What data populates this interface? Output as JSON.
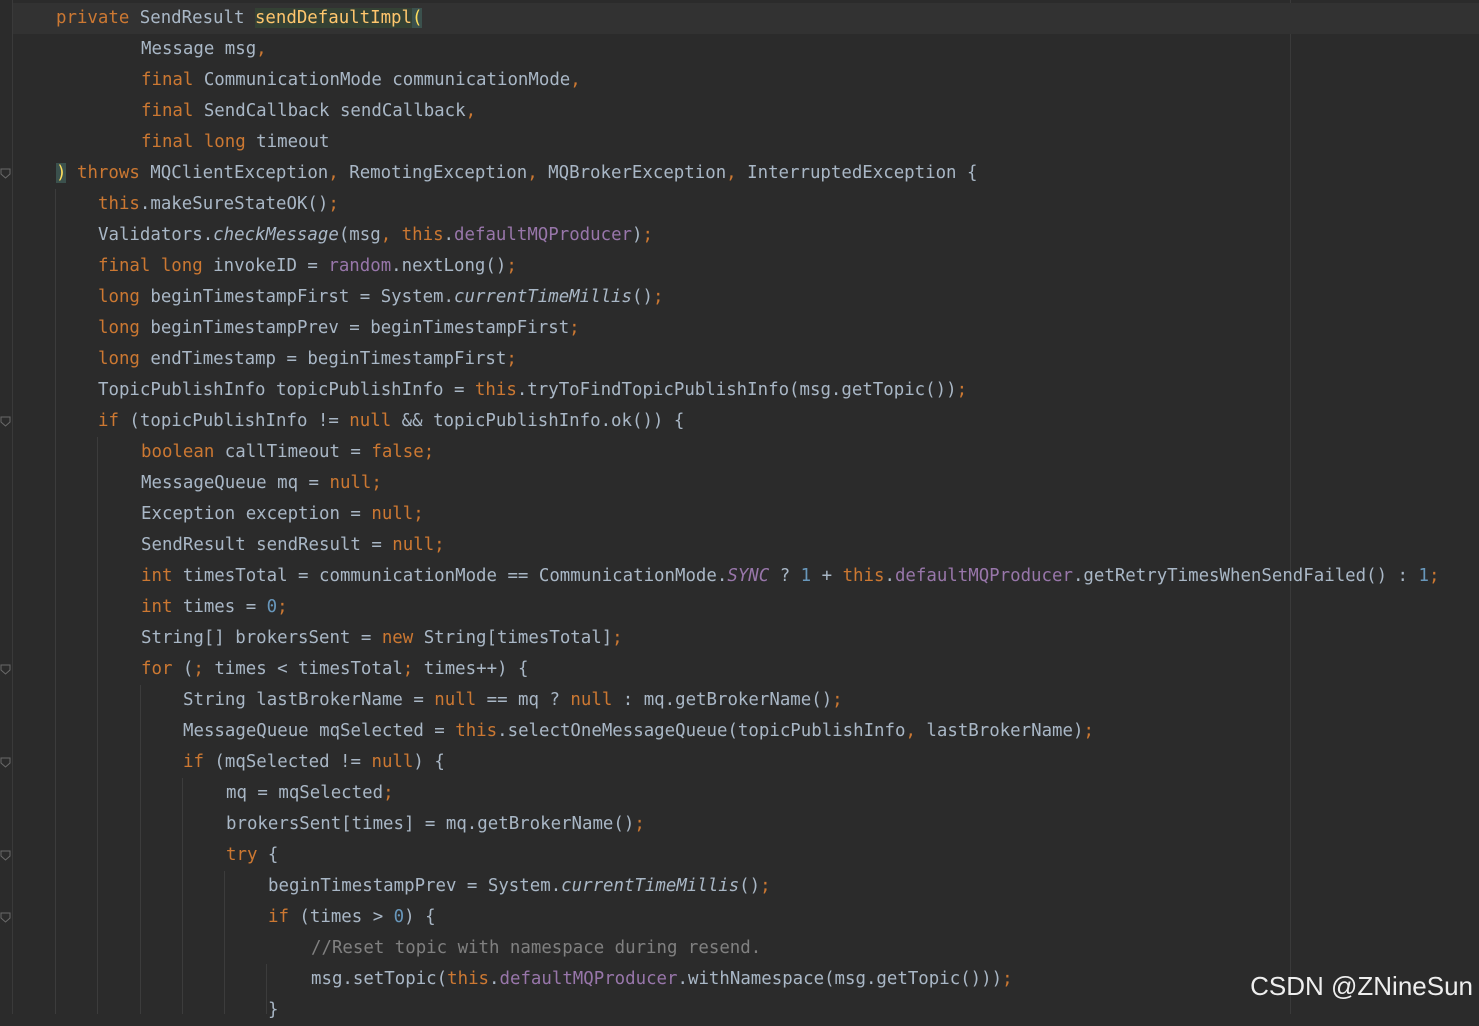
{
  "code_lines": [
    [
      {
        "t": "private ",
        "c": "kw"
      },
      {
        "t": "SendResult "
      },
      {
        "t": "sendDefaultImpl",
        "c": "hl"
      },
      {
        "t": "(",
        "c": "brace"
      }
    ],
    [
      {
        "t": "Message msg"
      },
      {
        "t": ",",
        "c": "kw"
      }
    ],
    [
      {
        "t": "final ",
        "c": "kw"
      },
      {
        "t": "CommunicationMode communicationMode"
      },
      {
        "t": ",",
        "c": "kw"
      }
    ],
    [
      {
        "t": "final ",
        "c": "kw"
      },
      {
        "t": "SendCallback sendCallback"
      },
      {
        "t": ",",
        "c": "kw"
      }
    ],
    [
      {
        "t": "final long ",
        "c": "kw"
      },
      {
        "t": "timeout"
      }
    ],
    [
      {
        "t": ")",
        "c": "brace"
      },
      {
        "t": " "
      },
      {
        "t": "throws ",
        "c": "kw"
      },
      {
        "t": "MQClientException"
      },
      {
        "t": ", ",
        "c": "kw"
      },
      {
        "t": "RemotingException"
      },
      {
        "t": ", ",
        "c": "kw"
      },
      {
        "t": "MQBrokerException"
      },
      {
        "t": ", ",
        "c": "kw"
      },
      {
        "t": "InterruptedException {"
      }
    ],
    [
      {
        "t": "this",
        "c": "kw"
      },
      {
        "t": ".makeSureStateOK()"
      },
      {
        "t": ";",
        "c": "kw"
      }
    ],
    [
      {
        "t": "Validators."
      },
      {
        "t": "checkMessage",
        "c": "ita"
      },
      {
        "t": "(msg"
      },
      {
        "t": ", ",
        "c": "kw"
      },
      {
        "t": "this",
        "c": "kw"
      },
      {
        "t": "."
      },
      {
        "t": "defaultMQProducer",
        "c": "fld"
      },
      {
        "t": ")"
      },
      {
        "t": ";",
        "c": "kw"
      }
    ],
    [
      {
        "t": "final long ",
        "c": "kw"
      },
      {
        "t": "invokeID = "
      },
      {
        "t": "random",
        "c": "fld"
      },
      {
        "t": ".nextLong()"
      },
      {
        "t": ";",
        "c": "kw"
      }
    ],
    [
      {
        "t": "long ",
        "c": "kw"
      },
      {
        "t": "beginTimestampFirst = System."
      },
      {
        "t": "currentTimeMillis",
        "c": "ita"
      },
      {
        "t": "()"
      },
      {
        "t": ";",
        "c": "kw"
      }
    ],
    [
      {
        "t": "long ",
        "c": "kw"
      },
      {
        "t": "beginTimestampPrev = beginTimestampFirst"
      },
      {
        "t": ";",
        "c": "kw"
      }
    ],
    [
      {
        "t": "long ",
        "c": "kw"
      },
      {
        "t": "endTimestamp = beginTimestampFirst"
      },
      {
        "t": ";",
        "c": "kw"
      }
    ],
    [
      {
        "t": "TopicPublishInfo topicPublishInfo = "
      },
      {
        "t": "this",
        "c": "kw"
      },
      {
        "t": ".tryToFindTopicPublishInfo(msg.getTopic())"
      },
      {
        "t": ";",
        "c": "kw"
      }
    ],
    [
      {
        "t": "if ",
        "c": "kw"
      },
      {
        "t": "(topicPublishInfo != "
      },
      {
        "t": "null ",
        "c": "kw"
      },
      {
        "t": "&& topicPublishInfo.ok()) {"
      }
    ],
    [
      {
        "t": "boolean ",
        "c": "kw"
      },
      {
        "t": "callTimeout = "
      },
      {
        "t": "false;",
        "c": "kw"
      }
    ],
    [
      {
        "t": "MessageQueue mq = "
      },
      {
        "t": "null;",
        "c": "kw"
      }
    ],
    [
      {
        "t": "Exception exception = "
      },
      {
        "t": "null;",
        "c": "kw"
      }
    ],
    [
      {
        "t": "SendResult sendResult = "
      },
      {
        "t": "null;",
        "c": "kw"
      }
    ],
    [
      {
        "t": "int ",
        "c": "kw"
      },
      {
        "t": "timesTotal = communicationMode == CommunicationMode."
      },
      {
        "t": "SYNC",
        "c": "fld ita"
      },
      {
        "t": " ? "
      },
      {
        "t": "1",
        "c": "num"
      },
      {
        "t": " + "
      },
      {
        "t": "this",
        "c": "kw"
      },
      {
        "t": "."
      },
      {
        "t": "defaultMQProducer",
        "c": "fld"
      },
      {
        "t": ".getRetryTimesWhenSendFailed() : "
      },
      {
        "t": "1",
        "c": "num"
      },
      {
        "t": ";",
        "c": "kw"
      }
    ],
    [
      {
        "t": "int ",
        "c": "kw"
      },
      {
        "t": "times = "
      },
      {
        "t": "0",
        "c": "num"
      },
      {
        "t": ";",
        "c": "kw"
      }
    ],
    [
      {
        "t": "String[] brokersSent = "
      },
      {
        "t": "new ",
        "c": "kw"
      },
      {
        "t": "String[timesTotal]"
      },
      {
        "t": ";",
        "c": "kw"
      }
    ],
    [
      {
        "t": "for ",
        "c": "kw"
      },
      {
        "t": "("
      },
      {
        "t": "; ",
        "c": "kw"
      },
      {
        "t": "times < timesTotal"
      },
      {
        "t": "; ",
        "c": "kw"
      },
      {
        "t": "times++) {"
      }
    ],
    [
      {
        "t": "String lastBrokerName = "
      },
      {
        "t": "null ",
        "c": "kw"
      },
      {
        "t": "== mq ? "
      },
      {
        "t": "null ",
        "c": "kw"
      },
      {
        "t": ": mq.getBrokerName()"
      },
      {
        "t": ";",
        "c": "kw"
      }
    ],
    [
      {
        "t": "MessageQueue mqSelected = "
      },
      {
        "t": "this",
        "c": "kw"
      },
      {
        "t": ".selectOneMessageQueue(topicPublishInfo"
      },
      {
        "t": ", ",
        "c": "kw"
      },
      {
        "t": "lastBrokerName)"
      },
      {
        "t": ";",
        "c": "kw"
      }
    ],
    [
      {
        "t": "if ",
        "c": "kw"
      },
      {
        "t": "(mqSelected != "
      },
      {
        "t": "null",
        "c": "kw"
      },
      {
        "t": ") {"
      }
    ],
    [
      {
        "t": "mq = mqSelected"
      },
      {
        "t": ";",
        "c": "kw"
      }
    ],
    [
      {
        "t": "brokersSent[times] = mq.getBrokerName()"
      },
      {
        "t": ";",
        "c": "kw"
      }
    ],
    [
      {
        "t": "try ",
        "c": "kw"
      },
      {
        "t": "{"
      }
    ],
    [
      {
        "t": "beginTimestampPrev = System."
      },
      {
        "t": "currentTimeMillis",
        "c": "ita"
      },
      {
        "t": "()"
      },
      {
        "t": ";",
        "c": "kw"
      }
    ],
    [
      {
        "t": "if ",
        "c": "kw"
      },
      {
        "t": "(times > "
      },
      {
        "t": "0",
        "c": "num"
      },
      {
        "t": ") {"
      }
    ],
    [
      {
        "t": "//Reset topic with namespace during resend.",
        "c": "cmt"
      }
    ],
    [
      {
        "t": "msg.setTopic("
      },
      {
        "t": "this",
        "c": "kw"
      },
      {
        "t": "."
      },
      {
        "t": "defaultMQProducer",
        "c": "fld"
      },
      {
        "t": ".withNamespace(msg.getTopic()))"
      },
      {
        "t": ";",
        "c": "kw"
      }
    ],
    [
      {
        "t": "}"
      }
    ]
  ],
  "watermark": "CSDN @ZNineSun",
  "colors": {
    "background": "#2b2b2b",
    "text": "#a9b7c6",
    "keyword": "#cc7832",
    "field": "#9876aa",
    "number": "#6897bb",
    "comment": "#808080",
    "method_highlight": "#ffc66d"
  }
}
